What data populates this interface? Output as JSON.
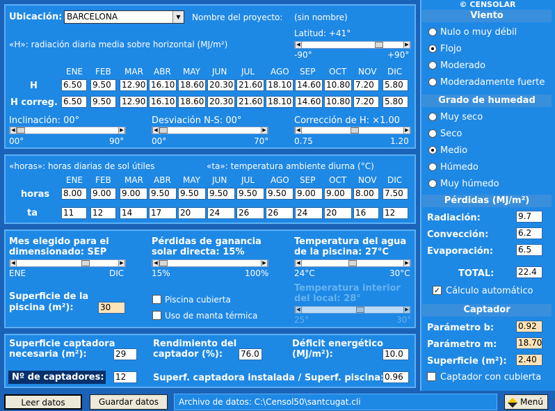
{
  "loc": {
    "ubicacion_label": "Ubicación:",
    "ubicacion_value": "BARCELONA",
    "proyecto_label": "Nombre del proyecto:",
    "proyecto_value": "(sin nombre)",
    "h_desc": "«H»: radiación diaria media sobre horizontal (MJ/m²)",
    "latitud_label": "Latitud:  +41°",
    "lat_min": "-90°",
    "lat_max": "+90°",
    "lat_value": 41
  },
  "months": [
    "ENE",
    "FEB",
    "MAR",
    "ABR",
    "MAY",
    "JUN",
    "JUL",
    "AGO",
    "SEP",
    "OCT",
    "NOV",
    "DIC"
  ],
  "h_row": {
    "label": "H",
    "values": [
      "6.50",
      "9.50",
      "12.90",
      "16.10",
      "18.60",
      "20.30",
      "21.60",
      "18.10",
      "14.60",
      "10.80",
      "7.20",
      "5.80"
    ]
  },
  "hc_row": {
    "label": "H correg.",
    "values": [
      "6.50",
      "9.50",
      "12.90",
      "16.10",
      "18.60",
      "20.30",
      "21.60",
      "18.10",
      "14.60",
      "10.80",
      "7.20",
      "5.80"
    ]
  },
  "sliders1": {
    "incl_label": "Inclinación: 00°",
    "incl_min": "00°",
    "incl_max": "90°",
    "desv_label": "Desviación N-S: 00°",
    "desv_min": "00°",
    "desv_max": "70°",
    "corr_label": "Corrección de H: ×1.00",
    "corr_min": "0.75",
    "corr_max": "1.20"
  },
  "sun": {
    "horas_desc": "«horas»: horas diarias de sol útiles",
    "ta_desc": "«ta»: temperatura ambiente diurna (°C)",
    "horas_label": "horas",
    "ta_label": "ta",
    "horas": [
      "8.00",
      "9.00",
      "9.00",
      "9.50",
      "9.50",
      "9.50",
      "9.50",
      "9.50",
      "9.00",
      "9.00",
      "8.00",
      "7.50"
    ],
    "ta": [
      "11",
      "12",
      "14",
      "17",
      "20",
      "24",
      "26",
      "26",
      "24",
      "20",
      "16",
      "12"
    ]
  },
  "dim": {
    "mes_label1": "Mes elegido para el",
    "mes_label2": "dimensionado: SEP",
    "mes_min": "ENE",
    "mes_max": "DIC",
    "perd_label1": "Pérdidas de ganancia",
    "perd_label2": "solar directa: 15%",
    "perd_min": "15%",
    "perd_max": "100%",
    "temp_label1": "Temperatura del agua",
    "temp_label2": "de la piscina: 27°C",
    "temp_min": "24°C",
    "temp_max": "30°C",
    "sup_label1": "Superficie de la",
    "sup_label2": "piscina (m²):",
    "sup_value": "30",
    "cubierta_label": "Piscina cubierta",
    "manta_label": "Uso de manta térmica",
    "tint_label1": "Temperatura interior",
    "tint_label2": "del local: 28°",
    "tint_min": "25°",
    "tint_max": "30°"
  },
  "res": {
    "supcap_label1": "Superficie captadora",
    "supcap_label2": "necesaria (m²):",
    "supcap_value": "29",
    "rend_label1": "Rendimiento del",
    "rend_label2": "captador (%):",
    "rend_value": "76.0",
    "def_label1": "Déficit energético",
    "def_label2": "(MJ/m²):",
    "def_value": "10.0",
    "ncap_label": "Nº de captadores:",
    "ncap_value": "12",
    "ratio_label": "Superf. captadora instalada / Superf. piscina:",
    "ratio_value": "0.96"
  },
  "right": {
    "copyright": "© CENSOLAR",
    "viento_title": "Viento",
    "viento": [
      "Nulo o muy débil",
      "Flojo",
      "Moderado",
      "Moderadamente fuerte"
    ],
    "hum_title": "Grado de humedad",
    "humedad": [
      "Muy seco",
      "Seco",
      "Medio",
      "Húmedo",
      "Muy húmedo"
    ],
    "perd_title": "Pérdidas (MJ/m²)",
    "rad_label": "Radiación:",
    "rad_value": "9.7",
    "conv_label": "Convección:",
    "conv_value": "6.2",
    "evap_label": "Evaporación:",
    "evap_value": "6.5",
    "total_label": "TOTAL:",
    "total_value": "22.4",
    "auto_label": "Cálculo automático",
    "cap_title": "Captador",
    "pb_label": "Parámetro b:",
    "pb_value": "0.92",
    "pm_label": "Parámetro m:",
    "pm_value": "18.70",
    "sup_label": "Superficie (m²):",
    "sup_value": "2.40",
    "capcub_label": "Captador con cubierta"
  },
  "bottom": {
    "leer": "Leer datos",
    "guardar": "Guardar datos",
    "archivo": "Archivo de datos: C:\\Censol50\\santcugat.cli",
    "menu": "Menú"
  }
}
